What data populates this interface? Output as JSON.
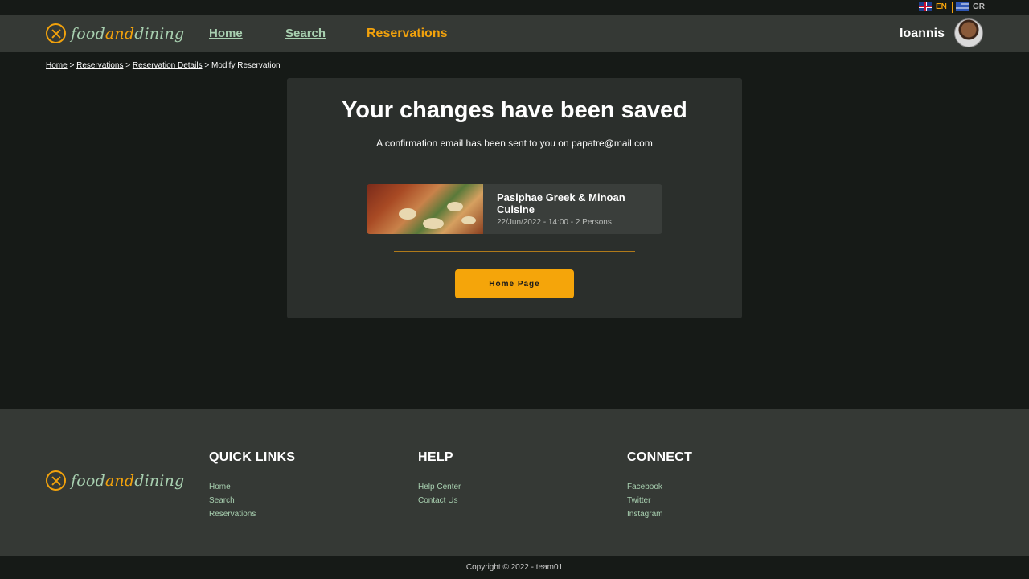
{
  "language": {
    "en": "EN",
    "gr": "GR"
  },
  "brand": {
    "part1": "food",
    "part2": "and",
    "part3": "dining"
  },
  "nav": {
    "home": "Home",
    "search": "Search",
    "reservations": "Reservations"
  },
  "user": {
    "name": "Ioannis"
  },
  "breadcrumb": {
    "home": "Home",
    "reservations": "Reservations",
    "details": "Reservation Details",
    "current": "Modify Reservation",
    "separator": ">"
  },
  "confirmation": {
    "title": "Your changes have been saved",
    "subtitle": "A confirmation email has been sent to you on papatre@mail.com"
  },
  "reservation": {
    "restaurant": "Pasiphae Greek & Minoan Cuisine",
    "details": "22/Jun/2022 - 14:00 - 2 Persons"
  },
  "actions": {
    "home_page": "Home Page"
  },
  "footer": {
    "quick_links": {
      "heading": "QUICK LINKS",
      "items": [
        "Home",
        "Search",
        "Reservations"
      ]
    },
    "help": {
      "heading": "HELP",
      "items": [
        "Help Center",
        "Contact Us"
      ]
    },
    "connect": {
      "heading": "CONNECT",
      "items": [
        "Facebook",
        "Twitter",
        "Instagram"
      ]
    },
    "copyright": "Copyright © 2022 - team01"
  },
  "colors": {
    "accent": "#f2a20c",
    "mint": "#a8d0b0",
    "header_bg": "#353935",
    "page_bg": "#161a17"
  }
}
